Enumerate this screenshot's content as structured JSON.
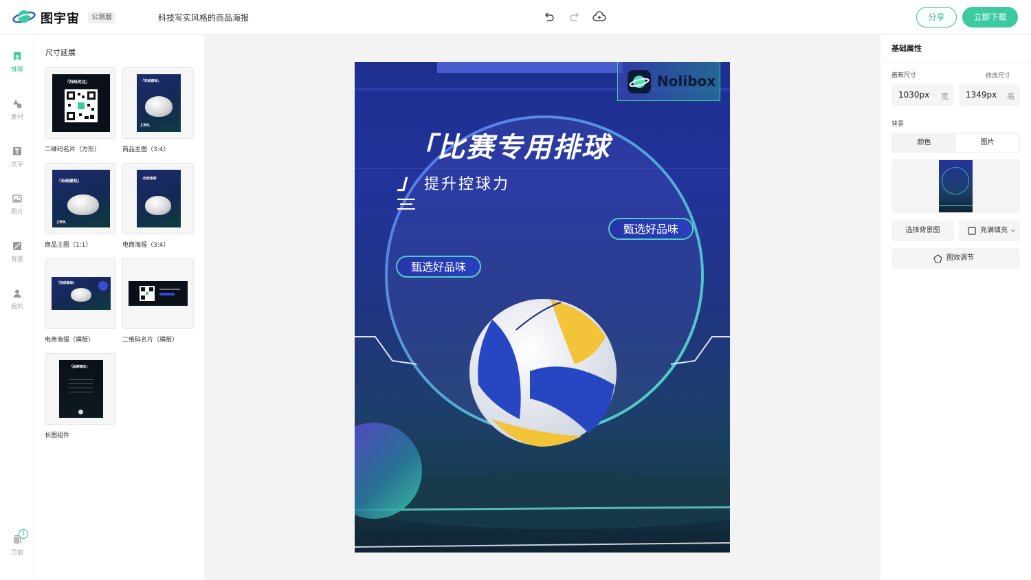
{
  "header": {
    "brand": "图宇宙",
    "badge": "公测版",
    "doc_title": "科技写实风格的商品海报",
    "share_label": "分享",
    "download_label": "立即下载"
  },
  "nav": {
    "items": [
      {
        "label": "推荐",
        "icon": "recommend-icon"
      },
      {
        "label": "素材",
        "icon": "material-icon"
      },
      {
        "label": "文字",
        "icon": "text-icon"
      },
      {
        "label": "图片",
        "icon": "image-icon"
      },
      {
        "label": "背景",
        "icon": "background-icon"
      },
      {
        "label": "我的",
        "icon": "user-icon"
      }
    ],
    "pages_label": "页面",
    "pages_count": "1"
  },
  "templates": {
    "title": "尺寸延展",
    "items": [
      {
        "label": "二维码名片（方形）",
        "head": "「扫码关注」"
      },
      {
        "label": "商品主图（3:4）",
        "head": "「无线鼠标」",
        "price": "199."
      },
      {
        "label": "商品主图（1:1）",
        "head": "「无线鼠标」",
        "price": "199."
      },
      {
        "label": "电商海报（3:4）",
        "head": "无线连接"
      },
      {
        "label": "电商海报（横版）",
        "head": "「无线鼠标」"
      },
      {
        "label": "二维码名片（横版）"
      },
      {
        "label": "长图组件",
        "head": "「品牌理念」"
      }
    ]
  },
  "poster": {
    "brand": "Nolibox",
    "title": "「比赛专用排球",
    "subtitle_quote": "」",
    "subtitle": "提升控球力",
    "pill_1": "甄选好品味",
    "pill_2": "甄选好品味"
  },
  "properties": {
    "title": "基础属性",
    "canvas_size_label": "画布尺寸",
    "edit_size_label": "修改尺寸",
    "width_value": "1030px",
    "width_unit": "宽",
    "height_value": "1349px",
    "height_unit": "高",
    "background_label": "背景",
    "tab_color": "颜色",
    "tab_image": "图片",
    "choose_bg_label": "选择背景图",
    "fill_label": "充满填充",
    "adjust_label": "图效调节"
  },
  "colors": {
    "accent": "#2bbf97",
    "accent_fill": "#3ccaa2",
    "poster_blue": "#22339b"
  }
}
